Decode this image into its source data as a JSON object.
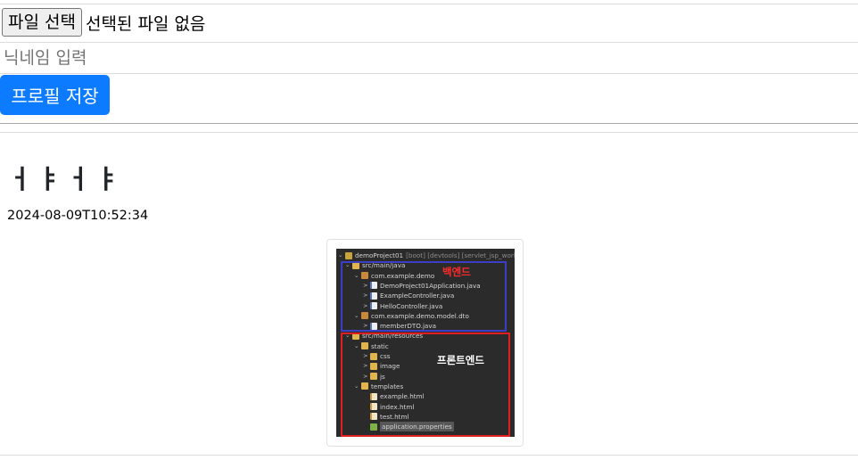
{
  "file_input": {
    "button_label": "파일 선택",
    "status": "선택된 파일 없음"
  },
  "nickname": {
    "placeholder": "닉네임 입력",
    "value": ""
  },
  "save_button": {
    "label": "프로필 저장",
    "color": "#0d7bff"
  },
  "post": {
    "title": "ㅓㅑㅓㅑ",
    "date": "2024-08-09T10:52:34",
    "image": {
      "annotations": {
        "backend": "백엔드",
        "frontend": "프론트엔드"
      },
      "tree": [
        {
          "arrow": "⌄",
          "icon": "proj",
          "label": "demoProject01",
          "suffix": "[boot] [devtools] [servlet_jsp_work",
          "selected": false
        },
        {
          "arrow": "⌄",
          "icon": "folder",
          "label": "src/main/java",
          "suffix": "",
          "selected": false
        },
        {
          "arrow": "⌄",
          "icon": "pkg",
          "label": "com.example.demo",
          "suffix": "",
          "selected": false
        },
        {
          "arrow": ">",
          "icon": "java",
          "label": "DemoProject01Application.java",
          "suffix": "",
          "selected": false
        },
        {
          "arrow": ">",
          "icon": "java",
          "label": "ExampleController.java",
          "suffix": "",
          "selected": false
        },
        {
          "arrow": ">",
          "icon": "java",
          "label": "HelloController.java",
          "suffix": "",
          "selected": false
        },
        {
          "arrow": "⌄",
          "icon": "pkg",
          "label": "com.example.demo.model.dto",
          "suffix": "",
          "selected": false
        },
        {
          "arrow": ">",
          "icon": "java",
          "label": "memberDTO.java",
          "suffix": "",
          "selected": false
        },
        {
          "arrow": "⌄",
          "icon": "folder",
          "label": "src/main/resources",
          "suffix": "",
          "selected": false
        },
        {
          "arrow": "⌄",
          "icon": "folder",
          "label": "static",
          "suffix": "",
          "selected": false
        },
        {
          "arrow": ">",
          "icon": "folder",
          "label": "css",
          "suffix": "",
          "selected": false
        },
        {
          "arrow": ">",
          "icon": "folder",
          "label": "image",
          "suffix": "",
          "selected": false
        },
        {
          "arrow": ">",
          "icon": "folder",
          "label": "js",
          "suffix": "",
          "selected": false
        },
        {
          "arrow": "⌄",
          "icon": "folder",
          "label": "templates",
          "suffix": "",
          "selected": false
        },
        {
          "arrow": "",
          "icon": "html",
          "label": "example.html",
          "suffix": "",
          "selected": false
        },
        {
          "arrow": "",
          "icon": "html",
          "label": "index.html",
          "suffix": "",
          "selected": false
        },
        {
          "arrow": "",
          "icon": "html",
          "label": "test.html",
          "suffix": "",
          "selected": false
        },
        {
          "arrow": "",
          "icon": "props",
          "label": "application.properties",
          "suffix": "",
          "selected": true
        }
      ]
    }
  }
}
